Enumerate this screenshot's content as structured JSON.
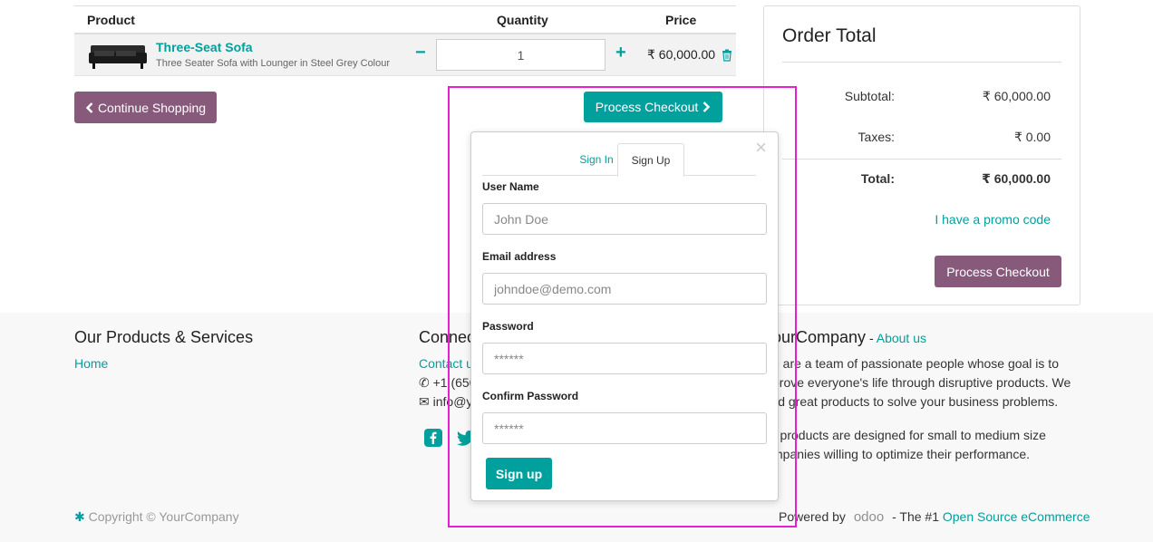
{
  "cart": {
    "headers": {
      "product": "Product",
      "quantity": "Quantity",
      "price": "Price"
    },
    "item": {
      "name": "Three-Seat Sofa",
      "description": "Three Seater Sofa with Lounger in Steel Grey Colour",
      "quantity": "1",
      "price": "₹ 60,000.00",
      "minus": "−",
      "plus": "+"
    },
    "continue_label": "Continue Shopping",
    "checkout_label": "Process Checkout"
  },
  "order": {
    "title": "Order Total",
    "subtotal_label": "Subtotal:",
    "subtotal_value": "₹ 60,000.00",
    "taxes_label": "Taxes:",
    "taxes_value": "₹ 0.00",
    "total_label": "Total:",
    "total_value": "₹ 60,000.00",
    "promo_label": "I have a promo code",
    "checkout_label": "Process Checkout"
  },
  "popover": {
    "close": "×",
    "tabs": [
      "Sign In",
      "Sign Up"
    ],
    "active_tab": "Sign Up",
    "username_label": "User Name",
    "username_placeholder": "John Doe",
    "email_label": "Email address",
    "email_placeholder": "johndoe@demo.com",
    "password_label": "Password",
    "password_placeholder": "******",
    "confirm_label": "Confirm Password",
    "confirm_placeholder": "******",
    "signup_label": "Sign up"
  },
  "footer": {
    "products_heading": "Our Products & Services",
    "home_link": "Home",
    "connect_heading_visible": "Connec",
    "contact_visible": "Contact u",
    "phone_visible": "+1 (650",
    "email_visible": "info@y",
    "company_heading_visible": "ourCompany",
    "about_prefix": " - ",
    "about_link": "About us",
    "about_lines": [
      "e are a team of passionate people whose goal is to",
      "prove everyone's life through disruptive products. We",
      "ild great products to solve your business problems."
    ],
    "products_lines": [
      "r products are designed for small to medium size",
      "mpanies willing to optimize their performance."
    ],
    "copyright": "Copyright © YourCompany",
    "powered_by": "Powered by",
    "odoo_logo": "odoo",
    "tagline_prefix": "- The #1 ",
    "tagline_link": "Open Source eCommerce"
  },
  "colors": {
    "accent": "#00A09D",
    "brand": "#875A7B",
    "highlight": "#E91ED0"
  }
}
